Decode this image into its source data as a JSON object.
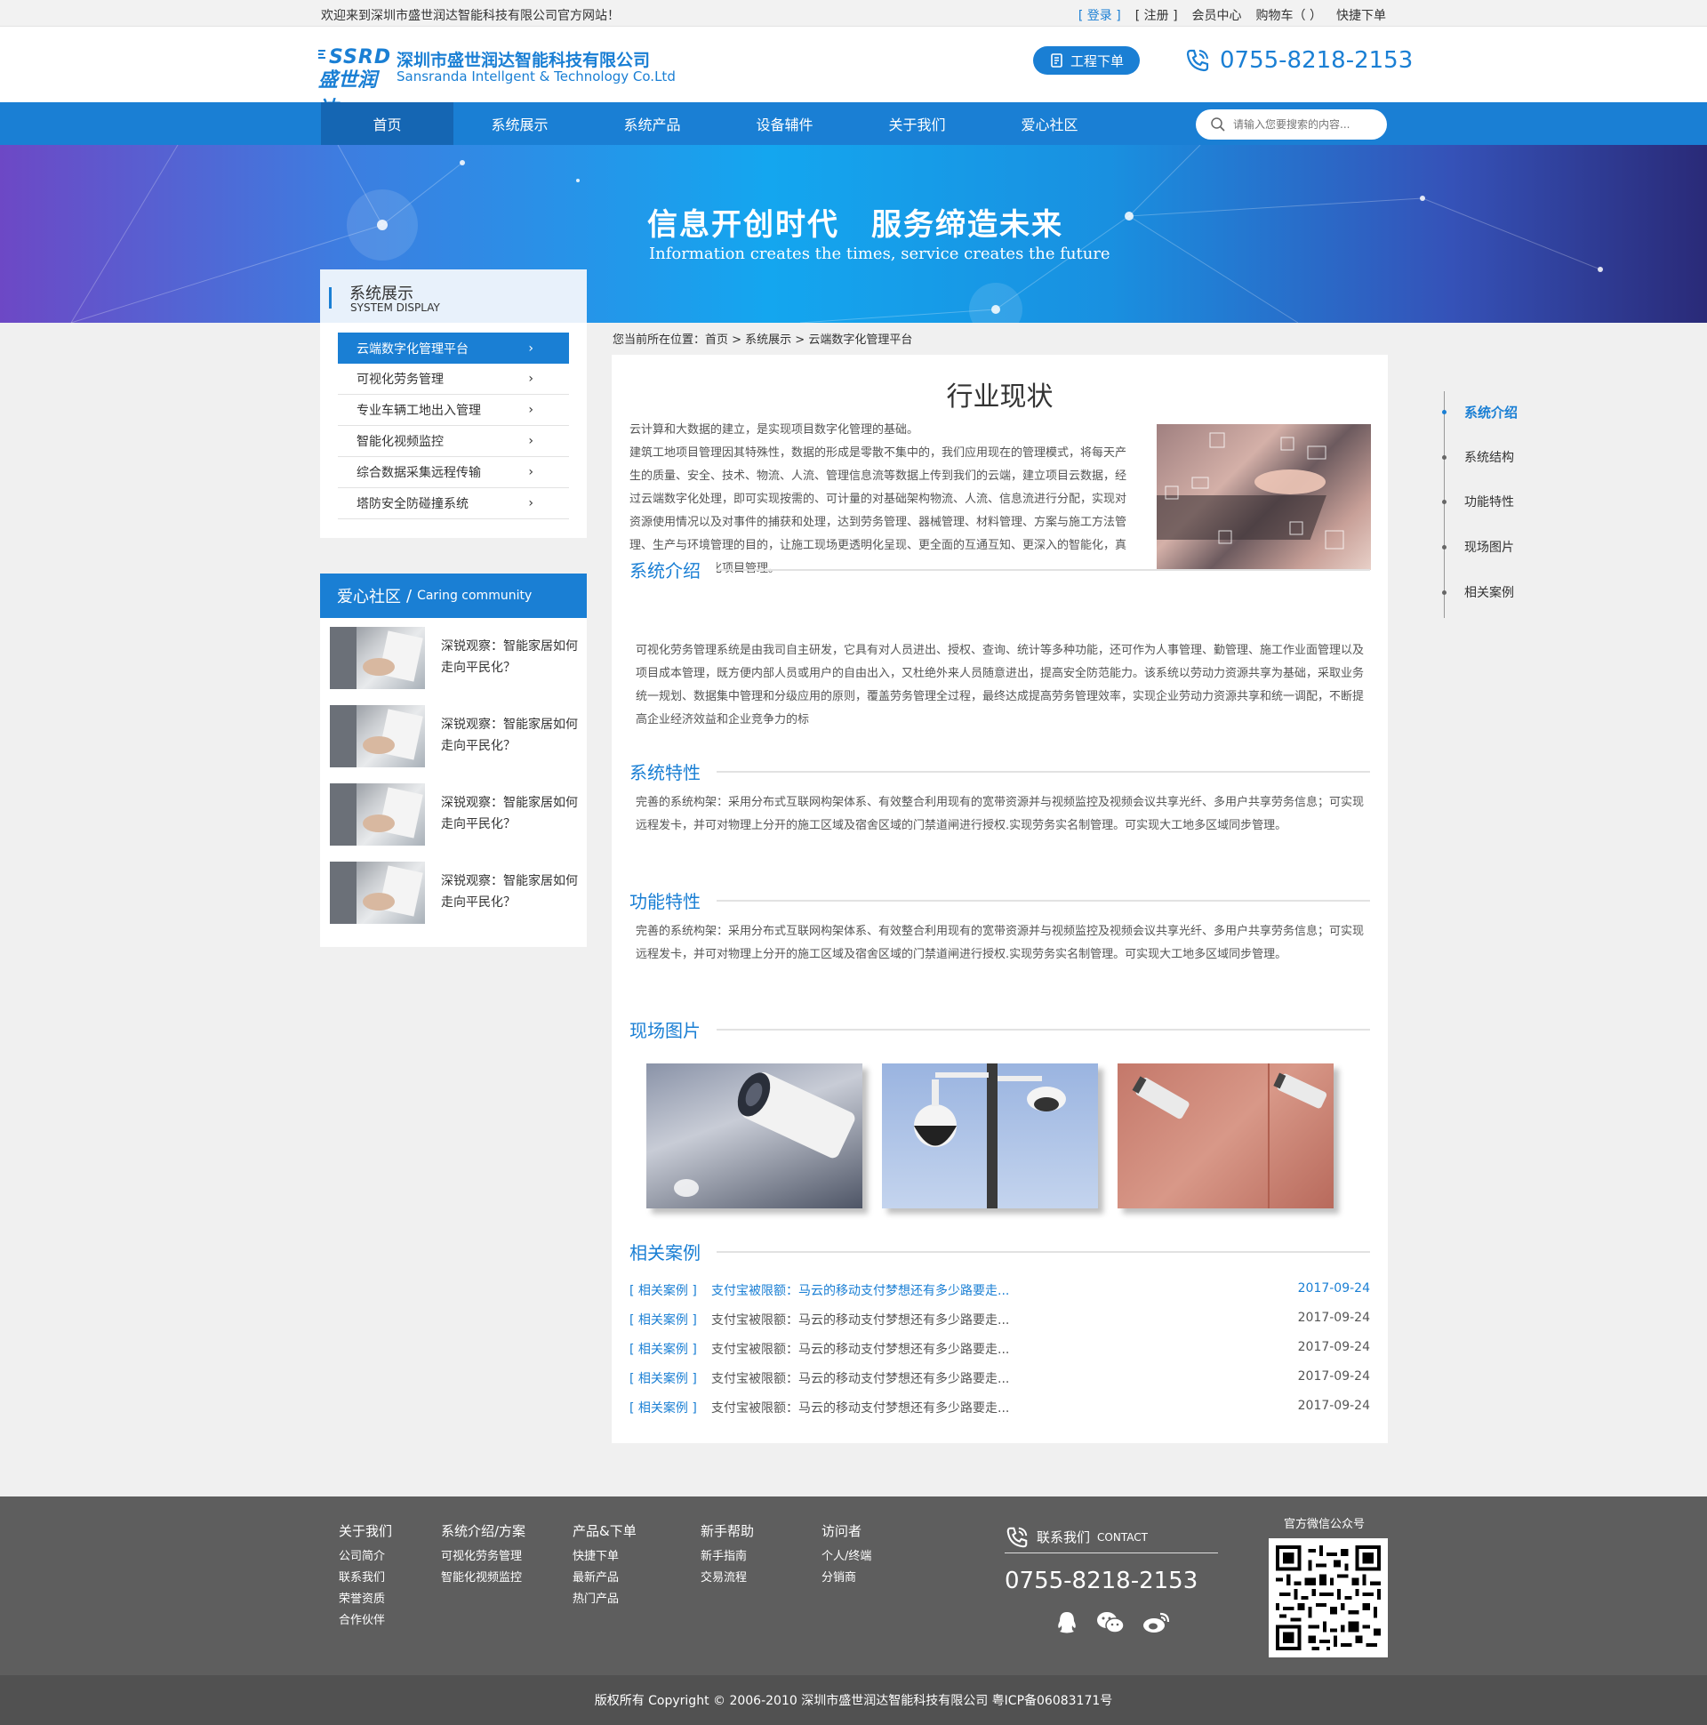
{
  "topbar": {
    "welcome": "欢迎来到深圳市盛世润达智能科技有限公司官方网站！",
    "login": "[ 登录 ]",
    "register": "[ 注册 ]",
    "member": "会员中心",
    "cart": "购物车（ ）",
    "quick_order": "快捷下单"
  },
  "header": {
    "logo_en": "SSRD",
    "logo_cn": "盛世润达",
    "company_name": "深圳市盛世润达智能科技有限公司",
    "company_en": "Sansranda Intellgent & Technology Co.Ltd",
    "order_button": "工程下单",
    "phone": "0755-8218-2153"
  },
  "nav": {
    "items": [
      "首页",
      "系统展示",
      "系统产品",
      "设备辅件",
      "关于我们",
      "爱心社区"
    ],
    "active_index": 0,
    "search_placeholder": "请输入您要搜索的内容..."
  },
  "banner": {
    "slogan": "信息开创时代　服务缔造未来",
    "slogan_en": "Information creates the times, service creates the future"
  },
  "sidebar": {
    "title_cn": "系统展示",
    "title_en": "SYSTEM DISPLAY",
    "menu": [
      "云端数字化管理平台",
      "可视化劳务管理",
      "专业车辆工地出入管理",
      "智能化视频监控",
      "综合数据采集远程传输",
      "塔防安全防碰撞系统"
    ],
    "active_index": 0,
    "arrow": "›",
    "community": {
      "title_cn": "爱心社区",
      "slash": "/",
      "title_en": "Caring community",
      "news": [
        "深锐观察：智能家居如何走向平民化？",
        "深锐观察：智能家居如何走向平民化？",
        "深锐观察：智能家居如何走向平民化？",
        "深锐观察：智能家居如何走向平民化？"
      ]
    }
  },
  "breadcrumb": "您当前所在位置：首页 > 系统展示 > 云端数字化管理平台",
  "main": {
    "title": "行业现状",
    "intro": [
      "云计算和大数据的建立，是实现项目数字化管理的基础。",
      "建筑工地项目管理因其特殊性，数据的形成是零散不集中的，我们应用现在的管理模式，将每天产生的质量、安全、技术、物流、人流、管理信息流等数据上传到我们的云端，建立项目云数据，经过云端数字化处理，即可实现按需的、可计量的对基础架构物流、人流、信息流进行分配，实现对资源使用情况以及对事件的捕获和处理，达到劳务管理、器械管理、材料管理、方案与施工方法管理、生产与环境管理的目的，让施工现场更透明化呈现、更全面的互通互知、更深入的智能化，真正实现云端数字化项目管理。"
    ],
    "sections": [
      {
        "title": "系统介绍",
        "body": "可视化劳务管理系统是由我司自主研发，它具有对人员进出、授权、查询、统计等多种功能，还可作为人事管理、勤管理、施工作业面管理以及项目成本管理，既方便内部人员或用户的自由出入，又杜绝外来人员随意进出，提高安全防范能力。该系统以劳动力资源共享为基础，采取业务统一规划、数据集中管理和分级应用的原则，覆盖劳务管理全过程，最终达成提高劳务管理效率，实现企业劳动力资源共享和统一调配，不断提高企业经济效益和企业竞争力的标"
      },
      {
        "title": "系统特性",
        "body": "完善的系统构架：采用分布式互联网构架体系、有效整合利用现有的宽带资源并与视频监控及视频会议共享光纤、多用户共享劳务信息；可实现远程发卡，并可对物理上分开的施工区域及宿舍区域的门禁道闸进行授权.实现劳务实名制管理。可实现大工地多区域同步管理。"
      },
      {
        "title": "功能特性",
        "body": "完善的系统构架：采用分布式互联网构架体系、有效整合利用现有的宽带资源并与视频监控及视频会议共享光纤、多用户共享劳务信息；可实现远程发卡，并可对物理上分开的施工区域及宿舍区域的门禁道闸进行授权.实现劳务实名制管理。可实现大工地多区域同步管理。"
      },
      {
        "title": "现场图片"
      },
      {
        "title": "相关案例"
      }
    ],
    "cases": [
      {
        "tag": "[ 相关案例 ]",
        "title": "支付宝被限额：马云的移动支付梦想还有多少路要走...",
        "date": "2017-09-24"
      },
      {
        "tag": "[ 相关案例 ]",
        "title": "支付宝被限额：马云的移动支付梦想还有多少路要走...",
        "date": "2017-09-24"
      },
      {
        "tag": "[ 相关案例 ]",
        "title": "支付宝被限额：马云的移动支付梦想还有多少路要走...",
        "date": "2017-09-24"
      },
      {
        "tag": "[ 相关案例 ]",
        "title": "支付宝被限额：马云的移动支付梦想还有多少路要走...",
        "date": "2017-09-24"
      },
      {
        "tag": "[ 相关案例 ]",
        "title": "支付宝被限额：马云的移动支付梦想还有多少路要走...",
        "date": "2017-09-24"
      }
    ]
  },
  "right_nav": {
    "items": [
      "系统介绍",
      "系统结构",
      "功能特性",
      "现场图片",
      "相关案例"
    ],
    "active_index": 0
  },
  "footer": {
    "columns": [
      {
        "title": "关于我们",
        "links": [
          "公司简介",
          "联系我们",
          "荣誉资质",
          "合作伙伴"
        ]
      },
      {
        "title": "系统介绍/方案",
        "links": [
          "可视化劳务管理",
          "智能化视频监控"
        ]
      },
      {
        "title": "产品&下单",
        "links": [
          "快捷下单",
          "最新产品",
          "热门产品"
        ]
      },
      {
        "title": "新手帮助",
        "links": [
          "新手指南",
          "交易流程"
        ]
      },
      {
        "title": "访问者",
        "links": [
          "个人/终端",
          "分销商"
        ]
      }
    ],
    "contact_cn": "联系我们",
    "contact_en": "CONTACT",
    "phone": "0755-8218-2153",
    "wechat_label": "官方微信公众号",
    "copyright": "版权所有  Copyright © 2006-2010  深圳市盛世润达智能科技有限公司  粤ICP备06083171号"
  },
  "colors": {
    "primary": "#1a7fd4",
    "footer_bg": "#5e5e5e",
    "copyright_bg": "#515151"
  }
}
